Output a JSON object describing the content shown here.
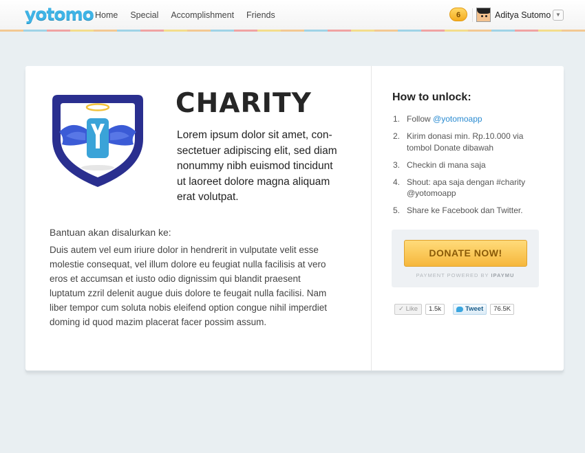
{
  "header": {
    "logo": "yotomo",
    "nav": [
      "Home",
      "Special",
      "Accomplishment",
      "Friends"
    ],
    "notification_count": "6",
    "user_name": "Aditya Sutomo",
    "dropdown_glyph": "▼"
  },
  "badge": {
    "title": "CHARITY",
    "intro": "Lorem ipsum dolor sit amet, con-sectetuer adipiscing elit, sed diam nonummy nibh euismod tincidunt ut laoreet dolore magna aliquam erat volutpat.",
    "icon": "angel-y-shield-icon"
  },
  "aid": {
    "heading": "Bantuan akan disalurkan ke:",
    "body": "Duis autem vel eum iriure dolor in hendrerit in vulputate velit esse molestie consequat, vel illum dolore eu feugiat nulla facilisis at vero eros et accumsan et iusto odio dignissim qui blandit praesent luptatum zzril delenit augue duis dolore te feugait nulla facilisi. Nam liber tempor cum soluta nobis eleifend option congue nihil imperdiet doming id quod mazim placerat facer possim assum."
  },
  "unlock": {
    "title": "How to unlock:",
    "steps": [
      {
        "num": "1.",
        "text": "Follow ",
        "link": "@yotomoapp"
      },
      {
        "num": "2.",
        "text": "Kirim donasi min. Rp.10.000 via tombol Donate dibawah"
      },
      {
        "num": "3.",
        "text": "Checkin di mana saja"
      },
      {
        "num": "4.",
        "text": "Shout: apa saja dengan #charity @yotomoapp"
      },
      {
        "num": "5.",
        "text": "Share ke Facebook dan Twitter."
      }
    ]
  },
  "donate": {
    "button": "DONATE NOW!",
    "powered_prefix": "PAYMENT POWERED BY ",
    "powered_brand": "IPAYMU"
  },
  "social": {
    "like_label": "Like",
    "like_count": "1.5k",
    "tweet_label": "Tweet",
    "tweet_count": "76.5K"
  },
  "colors": {
    "accent": "#3fb4e6",
    "shield_navy": "#2a2f8f",
    "wing_blue": "#3b5bd6",
    "donate_orange": "#f6b73c",
    "link": "#2a8bd1"
  }
}
